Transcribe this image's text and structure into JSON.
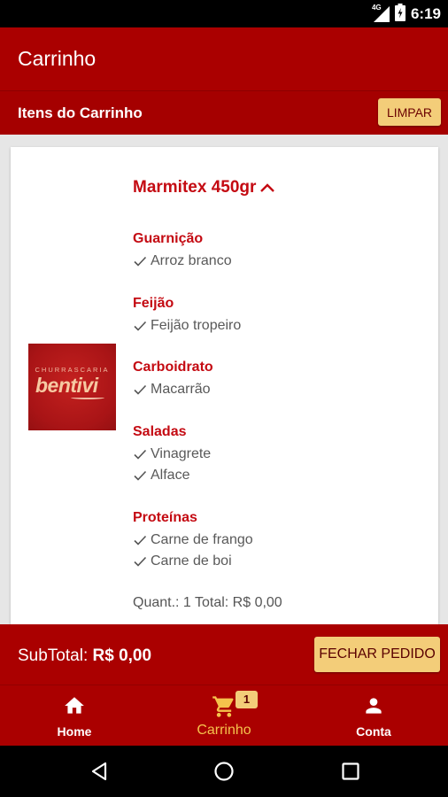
{
  "status_bar": {
    "network": "4G",
    "time": "6:19"
  },
  "app_bar": {
    "title": "Carrinho"
  },
  "cart_header": {
    "title": "Itens do Carrinho",
    "clear_label": "LIMPAR"
  },
  "cart_item": {
    "logo_top_text": "CHURRASCARIA",
    "logo_main_text": "bentivi",
    "name": "Marmitex 450gr",
    "categories": [
      {
        "label": "Guarnição",
        "options": [
          "Arroz branco"
        ]
      },
      {
        "label": "Feijão",
        "options": [
          "Feijão tropeiro"
        ]
      },
      {
        "label": "Carboidrato",
        "options": [
          "Macarrão"
        ]
      },
      {
        "label": "Saladas",
        "options": [
          "Vinagrete",
          "Alface"
        ]
      },
      {
        "label": "Proteínas",
        "options": [
          "Carne de frango",
          "Carne de boi"
        ]
      }
    ],
    "quantity_total": "Quant.: 1 Total: R$ 0,00"
  },
  "subtotal": {
    "label": "SubTotal:",
    "value": "R$ 0,00",
    "button_label": "FECHAR PEDIDO"
  },
  "bottom_nav": {
    "items": [
      {
        "label": "Home",
        "icon": "home-icon"
      },
      {
        "label": "Carrinho",
        "icon": "cart-icon",
        "badge": "1",
        "active": true
      },
      {
        "label": "Conta",
        "icon": "person-icon"
      }
    ]
  },
  "colors": {
    "primary": "#aa0000",
    "accent": "#f3cd79",
    "active_nav": "#f5c24c",
    "category_text": "#c40a12"
  }
}
